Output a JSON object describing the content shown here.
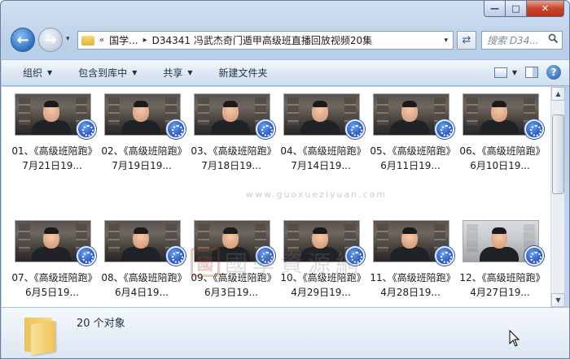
{
  "window": {
    "caption": {
      "minimize": "—",
      "maximize": "□",
      "close": "✕"
    }
  },
  "nav": {
    "back_glyph": "←",
    "forward_glyph": "→",
    "history_glyph": "▾"
  },
  "address": {
    "overflow": "«",
    "crumb_parent": "国学...",
    "separator": "▸",
    "current_folder": "D34341 冯武杰奇门遁甲高级班直播回放视频20集",
    "dropdown_glyph": "▾"
  },
  "refresh_glyph": "⇄",
  "search": {
    "placeholder": "搜索 D34...",
    "icon": "search-icon"
  },
  "toolbar": {
    "organize": "组织",
    "include_in_library": "包含到库中",
    "share": "共享",
    "new_folder": "新建文件夹",
    "dropdown_glyph": "▼",
    "help_glyph": "?"
  },
  "files": [
    {
      "name": "01、《高级班陪跑》7月21日19...",
      "thumb": "dark"
    },
    {
      "name": "02、《高级班陪跑》7月19日19...",
      "thumb": "dark"
    },
    {
      "name": "03、《高级班陪跑》7月18日19...",
      "thumb": "dark"
    },
    {
      "name": "04、《高级班陪跑》7月14日19...",
      "thumb": "dark"
    },
    {
      "name": "05、《高级班陪跑》6月11日19...",
      "thumb": "dark"
    },
    {
      "name": "06、《高级班陪跑》6月10日19...",
      "thumb": "dark"
    },
    {
      "name": "07、《高级班陪跑》6月5日19...",
      "thumb": "dark"
    },
    {
      "name": "08、《高级班陪跑》6月4日19...",
      "thumb": "dark"
    },
    {
      "name": "09、《高级班陪跑》6月3日19...",
      "thumb": "dark"
    },
    {
      "name": "10、《高级班陪跑》4月29日19...",
      "thumb": "dark"
    },
    {
      "name": "11、《高级班陪跑》4月28日19...",
      "thumb": "dark"
    },
    {
      "name": "12、《高级班陪跑》4月27日19...",
      "thumb": "bright"
    }
  ],
  "details": {
    "count": "20 个对象"
  },
  "watermark": {
    "seal": "國",
    "text": "國學資源網",
    "url": "www.guoxueziyuan.com"
  },
  "scrollbar": {
    "up": "▲",
    "down": "▼"
  }
}
